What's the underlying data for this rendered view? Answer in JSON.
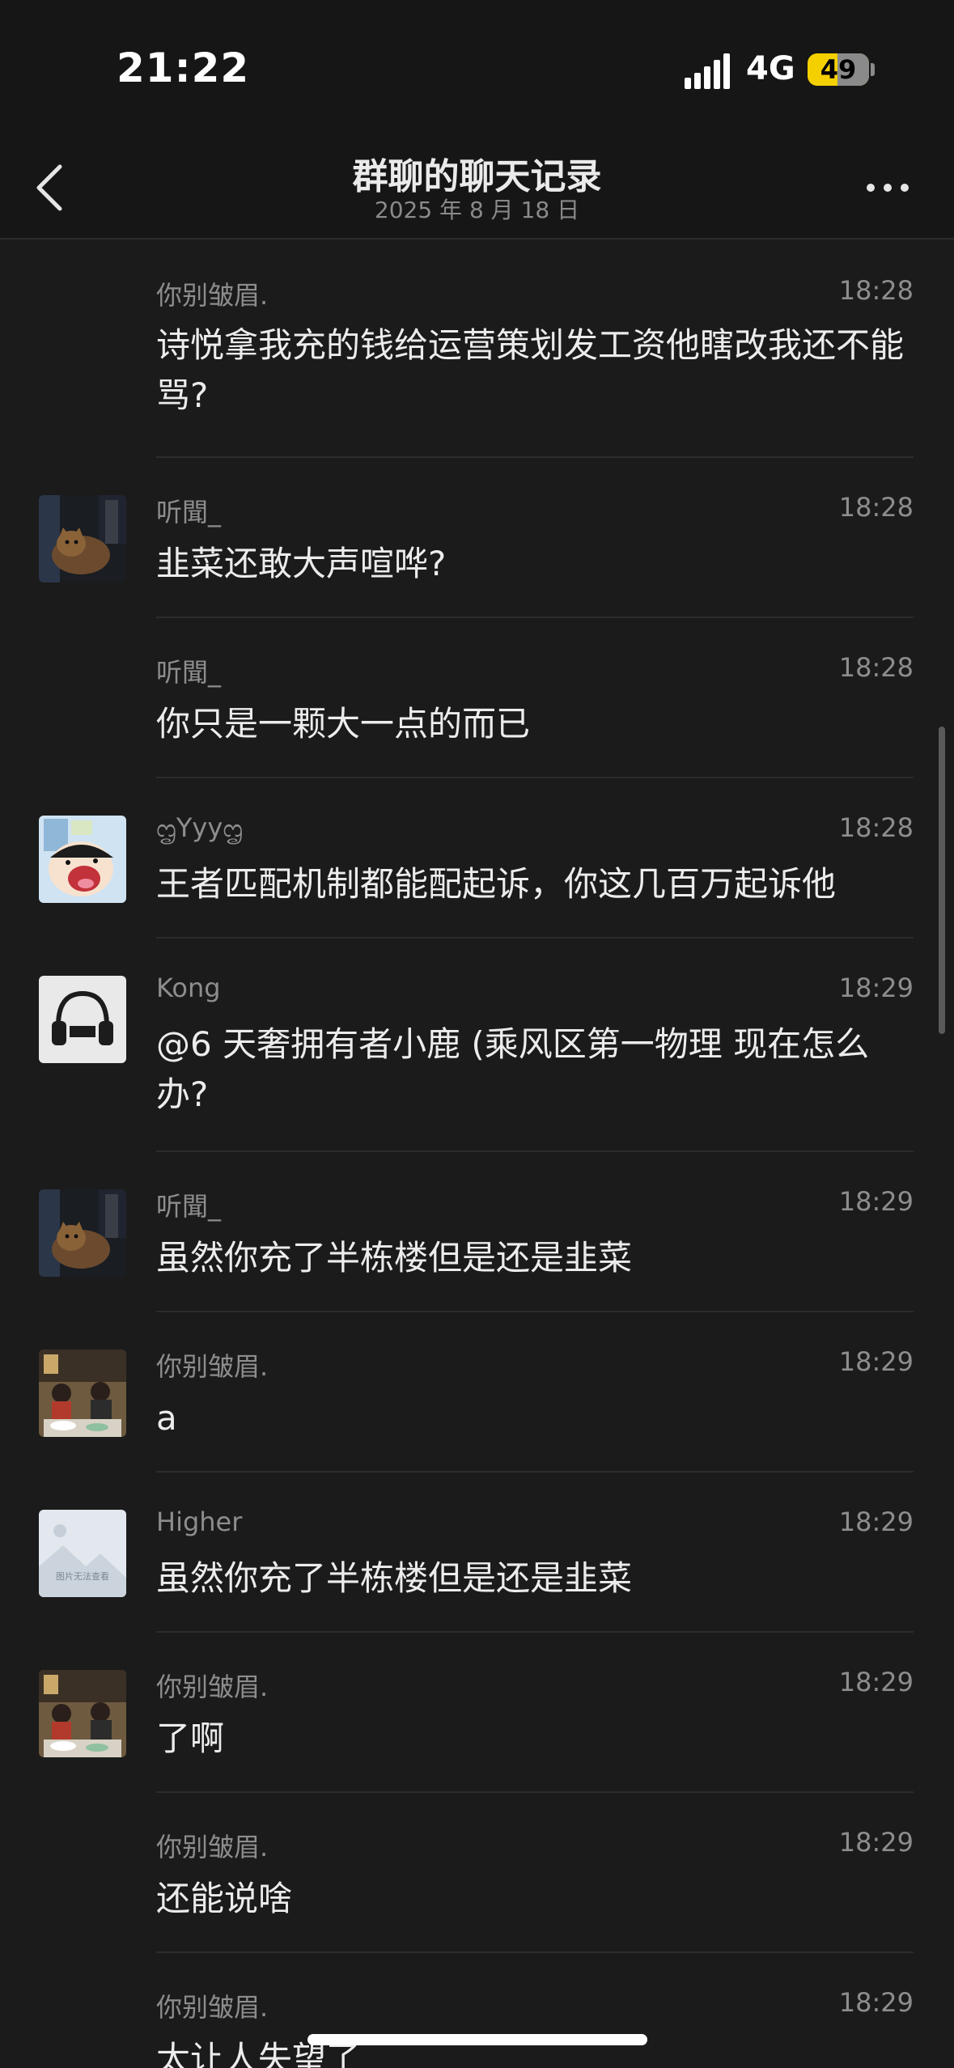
{
  "status_bar": {
    "time": "21:22",
    "network": "4G",
    "battery": "49",
    "battery_level": 0.49,
    "signal_icon": "signal-bars-icon"
  },
  "header": {
    "title": "群聊的聊天记录",
    "date": "2025 年 8 月 18 日",
    "back_icon": "chevron-left-icon",
    "more_icon": "more-dots-icon"
  },
  "messages": [
    {
      "sender": "你别皱眉.",
      "time": "18:28",
      "text": "诗悦拿我充的钱给运营策划发工资他瞎改我还不能骂?",
      "avatar": "none"
    },
    {
      "sender": "听聞_",
      "time": "18:28",
      "text": "韭菜还敢大声喧哗?",
      "avatar": "cat-photo"
    },
    {
      "sender": "听聞_",
      "time": "18:28",
      "text": "你只是一颗大一点的而已",
      "avatar": "none"
    },
    {
      "sender": "ᦗYyyᦗ",
      "time": "18:28",
      "text": "王者匹配机制都能配起诉，你这几百万起诉他",
      "avatar": "cartoon-boy"
    },
    {
      "sender": "Kong",
      "time": "18:29",
      "text": "@6 天奢拥有者小鹿 (乘风区第一物理 现在怎么办?",
      "avatar": "headphones"
    },
    {
      "sender": "听聞_",
      "time": "18:29",
      "text": "虽然你充了半栋楼但是还是韭菜",
      "avatar": "cat-photo"
    },
    {
      "sender": "你别皱眉.",
      "time": "18:29",
      "text": "a",
      "avatar": "restaurant-photo"
    },
    {
      "sender": "Higher",
      "time": "18:29",
      "text": "虽然你充了半栋楼但是还是韭菜",
      "avatar": "placeholder",
      "avatar_caption": "图片无法查看"
    },
    {
      "sender": "你别皱眉.",
      "time": "18:29",
      "text": "了啊",
      "avatar": "restaurant-photo"
    },
    {
      "sender": "你别皱眉.",
      "time": "18:29",
      "text": "还能说啥",
      "avatar": "none"
    },
    {
      "sender": "你别皱眉.",
      "time": "18:29",
      "text": "太让人失望了",
      "avatar": "none"
    }
  ]
}
